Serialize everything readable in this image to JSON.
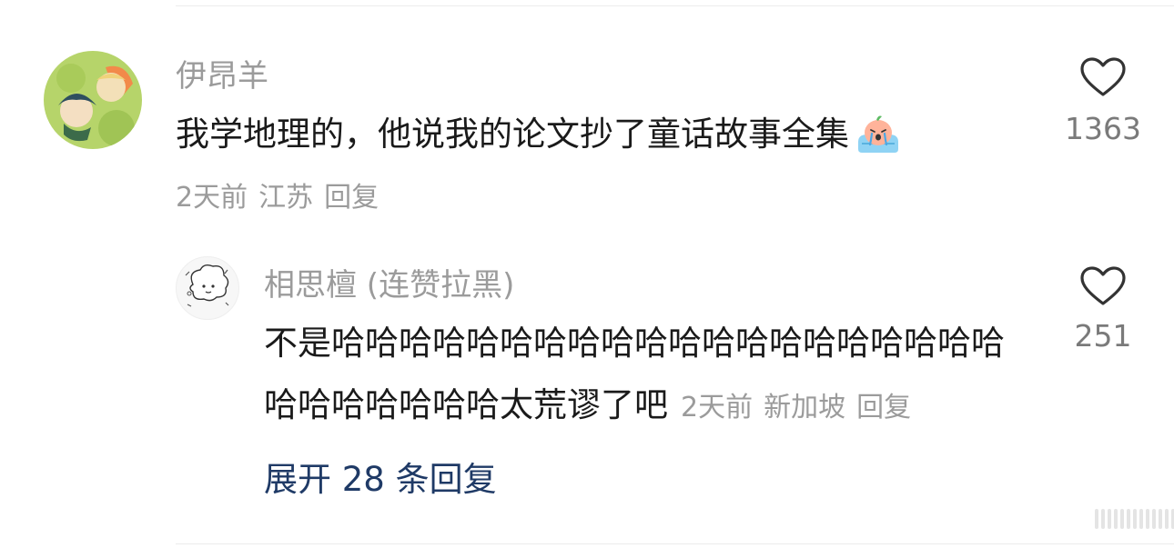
{
  "comment": {
    "username": "伊昂羊",
    "text": "我学地理的，他说我的论文抄了童话故事全集",
    "emoji": "crying-face-emoji",
    "time": "2天前",
    "location": "江苏",
    "reply_label": "回复",
    "likes": "1363"
  },
  "reply": {
    "username": "相思檀 (连赞拉黑)",
    "text_line1": "不是哈哈哈哈哈哈哈哈哈哈哈哈哈哈哈哈哈哈哈哈",
    "text_line2": "哈哈哈哈哈哈哈太荒谬了吧",
    "time": "2天前",
    "location": "新加坡",
    "reply_label": "回复",
    "likes": "251"
  },
  "expand_label": "展开 28 条回复",
  "colors": {
    "username": "#9b9b9b",
    "body_text": "#1a1a1a",
    "meta_text": "#9b9b9b",
    "link": "#1f3a66",
    "heart_stroke": "#333333"
  }
}
